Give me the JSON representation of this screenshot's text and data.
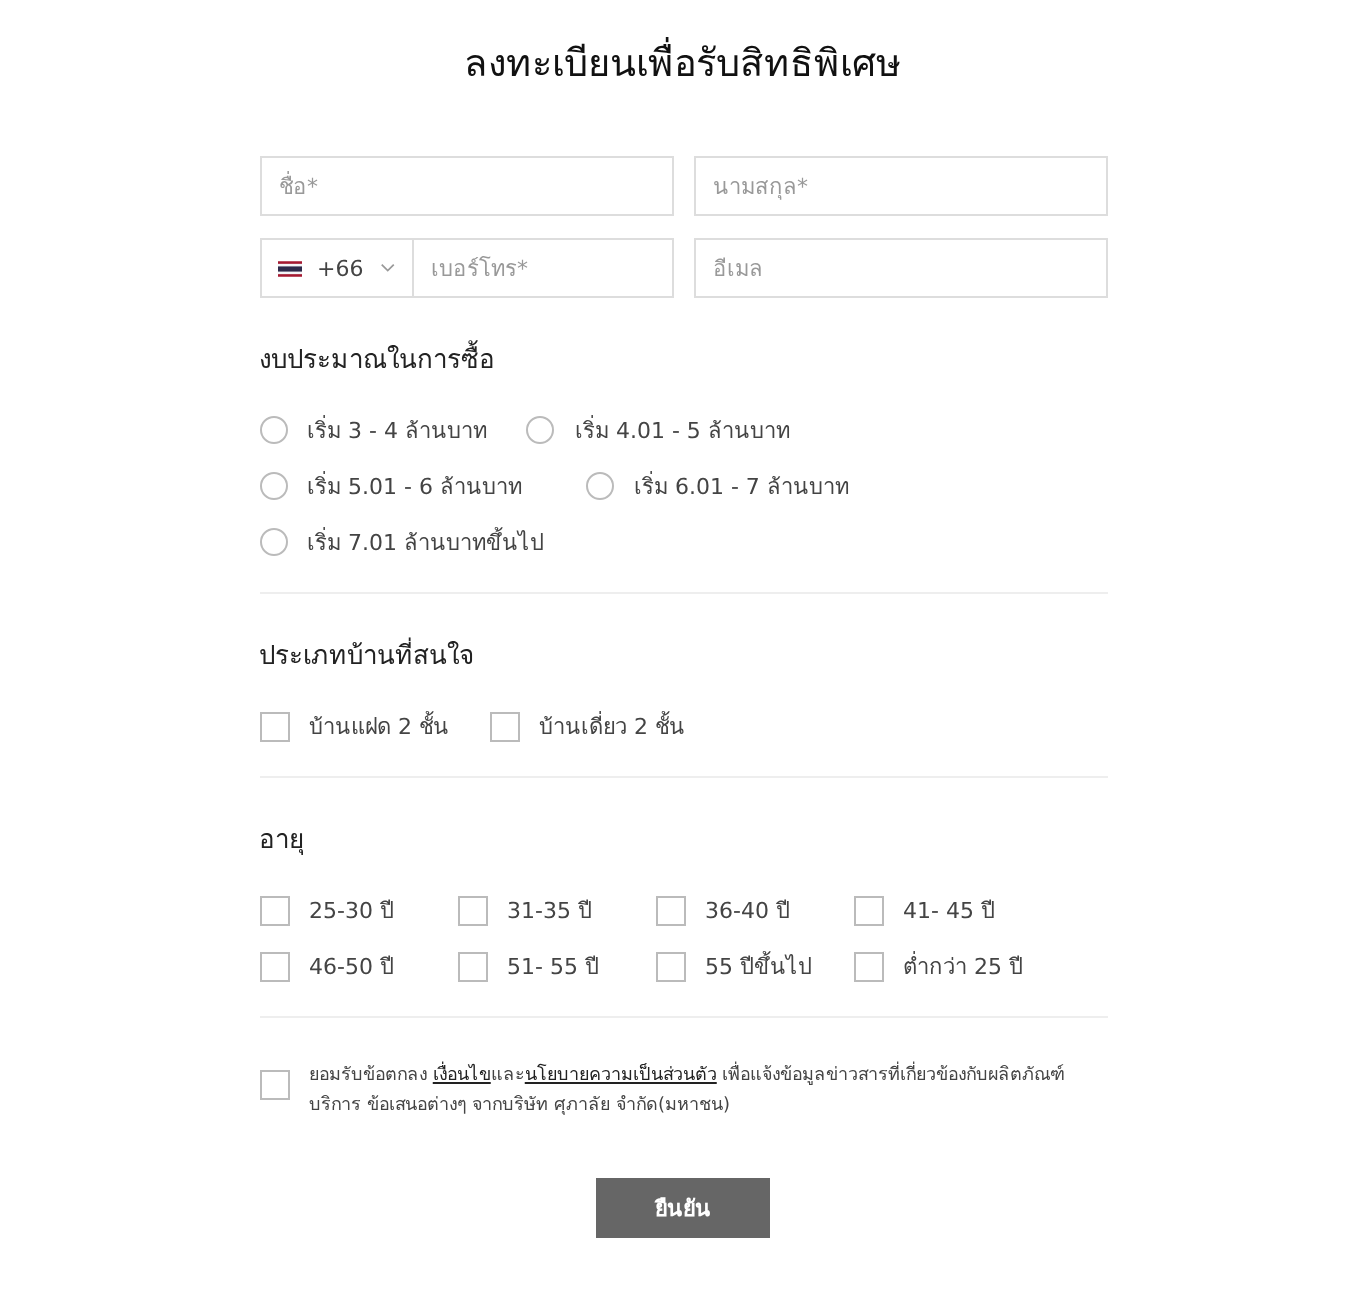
{
  "title": "ลงทะเบียนเพื่อรับสิทธิพิเศษ",
  "fields": {
    "first_name": {
      "placeholder": "ชื่อ*"
    },
    "last_name": {
      "placeholder": "นามสกุล*"
    },
    "country_code": "+66",
    "phone": {
      "placeholder": "เบอร์โทร*"
    },
    "email": {
      "placeholder": "อีเมล"
    }
  },
  "budget": {
    "heading": "งบประมาณในการซื้อ",
    "rows": [
      [
        {
          "label": "เริ่ม 3 - 4 ล้านบาท",
          "selected": false
        },
        {
          "label": "เริ่ม 4.01 - 5 ล้านบาท",
          "selected": false
        }
      ],
      [
        {
          "label": "เริ่ม 5.01 - 6 ล้านบาท",
          "selected": false
        },
        {
          "label": "เริ่ม 6.01 - 7 ล้านบาท",
          "selected": false
        }
      ],
      [
        {
          "label": "เริ่ม 7.01 ล้านบาทขึ้นไป",
          "selected": false
        }
      ]
    ]
  },
  "house_type": {
    "heading": "ประเภทบ้านที่สนใจ",
    "rows": [
      [
        {
          "label": "บ้านแฝด 2 ชั้น",
          "checked": false
        },
        {
          "label": "บ้านเดี่ยว 2 ชั้น",
          "checked": false
        }
      ]
    ]
  },
  "age": {
    "heading": "อายุ",
    "rows": [
      [
        {
          "label": "25-30 ปี",
          "checked": false
        },
        {
          "label": "31-35 ปี",
          "checked": false
        },
        {
          "label": "36-40 ปี",
          "checked": false
        },
        {
          "label": "41- 45 ปี",
          "checked": false
        }
      ],
      [
        {
          "label": "46-50 ปี",
          "checked": false
        },
        {
          "label": "51- 55 ปี",
          "checked": false
        },
        {
          "label": "55 ปีขึ้นไป",
          "checked": false
        },
        {
          "label": "ต่ำกว่า 25 ปี",
          "checked": false
        }
      ]
    ]
  },
  "consent": {
    "checked": false,
    "parts": [
      {
        "kind": "text",
        "text": "ยอมรับข้อตกลง "
      },
      {
        "kind": "link",
        "text": "เงื่อนไข"
      },
      {
        "kind": "text",
        "text": "และ"
      },
      {
        "kind": "link",
        "text": "นโยบายความเป็นส่วนตัว"
      },
      {
        "kind": "text",
        "text": " เพื่อแจ้งข้อมูลข่าวสารที่เกี่ยวข้องกับผลิตภัณฑ์ บริการ ข้อเสนอต่างๆ จากบริษัท ศุภาลัย จำกัด(มหาชน)"
      }
    ]
  },
  "submit": "ยืนยัน"
}
